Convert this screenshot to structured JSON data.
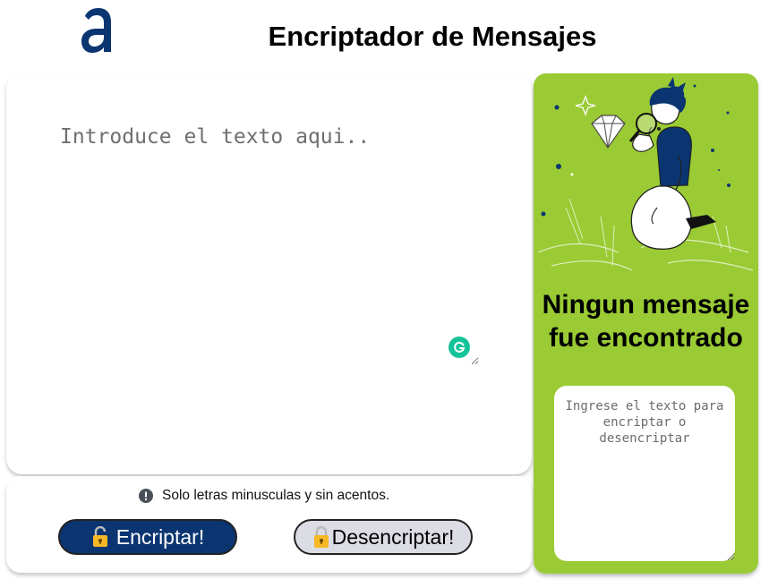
{
  "header": {
    "logo_alt": "a",
    "title": "Encriptador de Mensajes"
  },
  "input": {
    "placeholder": "Introduce el texto aqui..",
    "value": ""
  },
  "controls": {
    "notice_icon": "info-icon",
    "notice": "Solo letras minusculas y sin acentos.",
    "encrypt_label": "Encriptar!",
    "decrypt_label": "Desencriptar!",
    "encrypt_icon": "unlocked-padlock-icon",
    "decrypt_icon": "locked-padlock-icon"
  },
  "output": {
    "empty_title": "Ningun mensaje fue encontrado",
    "placeholder": "Ingrese el texto para encriptar o desencriptar",
    "value": ""
  },
  "colors": {
    "brand_blue": "#0a3571",
    "panel_green": "#9acb34",
    "decrypt_button": "#dcdde4",
    "grammarly_green": "#15c39a"
  }
}
